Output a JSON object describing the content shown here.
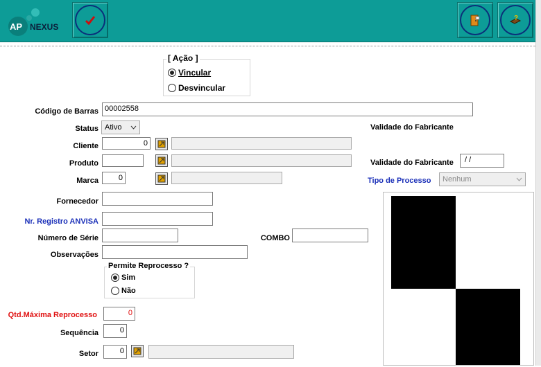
{
  "app": {
    "logo_text_left": "AP",
    "logo_text_right": "NEXUS"
  },
  "toolbar": {
    "confirm_icon": "check-icon",
    "exit_icon": "exit-door-icon",
    "help_icon": "help-book-icon"
  },
  "acao": {
    "legend": "[ Ação ]",
    "opt_vincular": "Vincular",
    "opt_desvincular": "Desvincular",
    "selected": "Vincular"
  },
  "form": {
    "codigo_barras_label": "Código de Barras",
    "codigo_barras_value": "00002558",
    "status_label": "Status",
    "status_value": "Ativo",
    "cliente_label": "Cliente",
    "cliente_value": "0",
    "cliente_desc": "",
    "produto_label": "Produto",
    "produto_value": "",
    "produto_desc": "",
    "marca_label": "Marca",
    "marca_value": "0",
    "marca_desc": "",
    "fornecedor_label": "Fornecedor",
    "fornecedor_value": "",
    "anvisa_label": "Nr. Registro ANVISA",
    "anvisa_value": "",
    "serie_label": "Número de Série",
    "serie_value": "",
    "combo_label": "COMBO",
    "combo_value": "",
    "obs_label": "Observações",
    "obs_value": "",
    "reprocesso_legend": "Permite Reprocesso ?",
    "opt_sim": "Sim",
    "opt_nao": "Não",
    "reprocesso_selected": "Sim",
    "qtd_label": "Qtd.Máxima Reprocesso",
    "qtd_value": "0",
    "sequencia_label": "Sequência",
    "sequencia_value": "0",
    "setor_label": "Setor",
    "setor_value": "0",
    "setor_desc": ""
  },
  "right": {
    "validade_header": "Validade do Fabricante",
    "validade_label": "Validade do Fabricante",
    "validade_value": " / /",
    "tipo_label": "Tipo de Processo",
    "tipo_value": "Nenhum"
  },
  "colors": {
    "toolbar": "#0d9c97",
    "link_blue": "#1a2fb8",
    "alert_red": "#e01010"
  }
}
